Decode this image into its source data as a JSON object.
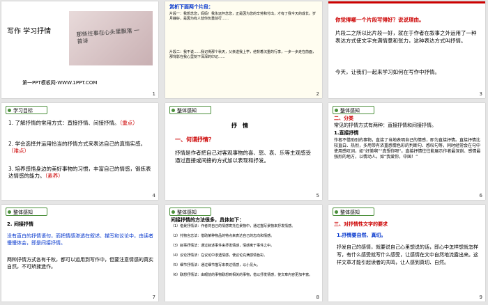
{
  "slides": [
    {
      "num": "1",
      "title": "写作 学习抒情",
      "site": "第一PPT模板网-WWW.1PPT.COM",
      "handwriting": "那些往事在心头里飘落 一首诗"
    },
    {
      "num": "2",
      "heading": "赏析下面两个片段：",
      "frag1": "片段一：我想念您，妈妈！我永远怀念您，正是因为您的辛劳和付出，才有了我今天的成长。岁月静好，是因为有人替你负重前行……",
      "frag2": "片段二：我不说……我记得那个秋天，父亲送我上学，他背着沉重的行李，一步一步走在前面，那背影在我心里刻下深深的印记……"
    },
    {
      "num": "3",
      "q": "你觉得哪一个片段写得好？说说理由。",
      "a1": "片段二之所以比片段一好，就在于作者在叙事之外运用了一种表达方式使文字充满情意和张力，这种表达方式叫抒情。",
      "a2": "今天，让我们一起来学习如何在写作中抒情。"
    },
    {
      "num": "4",
      "label": "学习目标",
      "g1": "1. 了解抒情的常用方式：直接抒情、间接抒情。",
      "g1b": "（重点）",
      "g2": "2. 学会选择并运用恰当的抒情方式来表达自己的真情实感。",
      "g2b": "（难点）",
      "g3": "3. 培养感悟身边的美好事物的习惯，丰富自己的情感，锻炼表达情感的能力。",
      "g3b": "（素养）"
    },
    {
      "num": "5",
      "label": "整体感知",
      "title": "抒　情",
      "q": "一、何谓抒情？",
      "def": "抒情是作者把自己对客观事物的喜、怒、哀、乐等主观感受通过直接或间接的方式加以表现和抒发。"
    },
    {
      "num": "6",
      "label": "整体感知",
      "sec": "二、分类",
      "intro": "常见的抒情方式有两种：直接抒情和间接抒情。",
      "sub": "1.直接抒情",
      "body": "作者不借助别的事物，直接了当地表明自己的情感，即为直接抒情。直接抒情比较直白、热烈，多用带有浓重感情色彩的判断句、感叹句等，同时经常会在句中使用感叹词，如“好美啊”“真想你呀”。直接抒情往往能展示作者最深刻、感情最强烈的地方，以情动人。如“我爱你，中国！”"
    },
    {
      "num": "7",
      "label": "整体感知",
      "sub": "2. 间接抒情",
      "body": "没有直白的抒情语句，而把情感渗透在叙述、描写和议论中，由读者慢慢体会，即是间接抒情。",
      "body2": "两种抒情方式各有千秋，都可以运用到写作中，但要注意情感的真实自然，不可矫揉造作。"
    },
    {
      "num": "8",
      "label": "整体感知",
      "head": "间接抒情的方法很多，具体如下：",
      "items": [
        "（1）借景抒情法：作者将自己的情感寄托在景物中，通过描写景物来抒发情感。",
        "（2）托物言志法：借助某种物品的特点来表达自己的志向和情感。",
        "（3）叙事抒情法：通过叙述事件来抒发情感，情感寓于事件之中。",
        "（4）议论抒情法：在议论中渗透情感，使议论充满感情色彩。",
        "（5）细节抒情法：通过细节描写来表达情感，以小见大。",
        "（6）联想抒情法：由眼前的事物联想到相关的事物，借以抒发情感，使文章内容更加丰富。"
      ]
    },
    {
      "num": "9",
      "label": "整体感知",
      "sec": "三、对抒情性文字的要求",
      "sub": "1.抒情要自然、真切。",
      "body": "抒发自己的感情，就要说自己心里想说的话，即心中怎样想就怎样写，有什么感受就写什么感受，让感情在文中自然地流露出来。这样文章才能引起读者的共鸣，让人感到真切、自然。"
    }
  ]
}
